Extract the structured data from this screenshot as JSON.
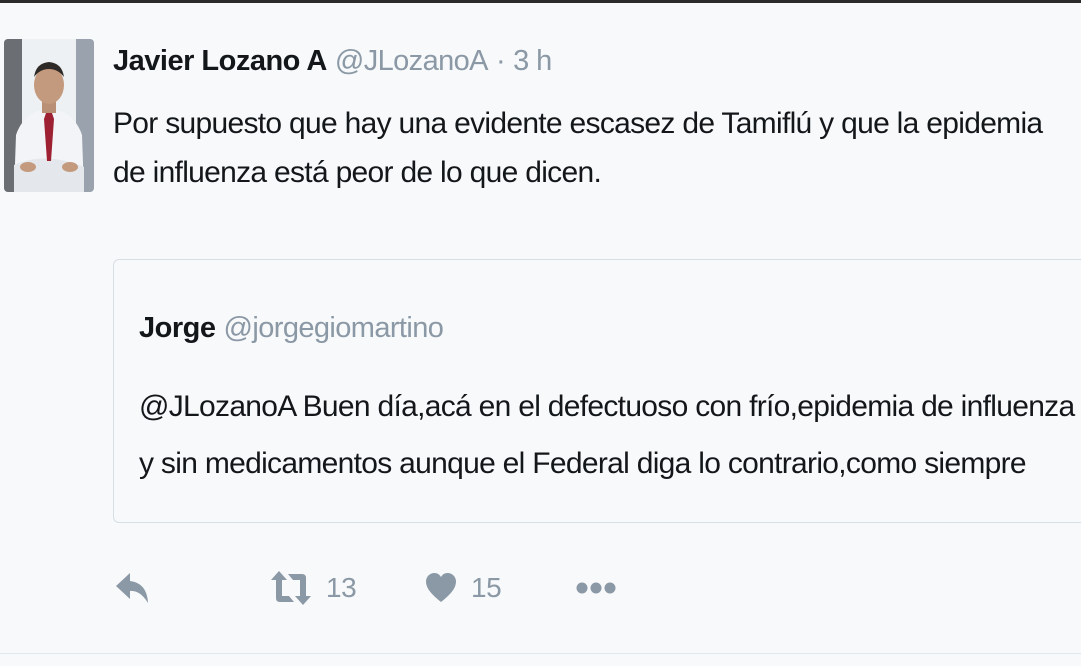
{
  "tweet": {
    "author_name": "Javier Lozano A",
    "author_handle": "@JLozanoA",
    "separator": "·",
    "time": "3 h",
    "text": "Por supuesto que hay una evidente escasez de Tamiflú y que la epidemia de influenza está peor de lo que dicen."
  },
  "quoted_tweet": {
    "author_name": "Jorge",
    "author_handle": "@jorgegiomartino",
    "text": "@JLozanoA Buen día,acá en el defectuoso con frío,epidemia de influenza y sin medicamentos aunque el Federal diga lo contrario,como siempre"
  },
  "actions": {
    "reply_icon": "reply-icon",
    "retweet_icon": "retweet-icon",
    "retweet_count": "13",
    "like_icon": "heart-icon",
    "like_count": "15",
    "more_icon": "more-dots-icon"
  },
  "colors": {
    "background": "#f7f9fa",
    "text": "#14171a",
    "secondary_text": "#8b98a5",
    "border": "#d7dee4"
  }
}
